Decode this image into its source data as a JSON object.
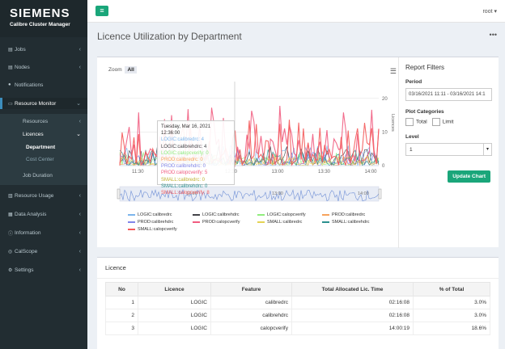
{
  "sidebar": {
    "brand": "SIEMENS",
    "product": "Calibre Cluster Manager",
    "items": [
      {
        "label": "Jobs",
        "icon": "server-icon"
      },
      {
        "label": "Nodes",
        "icon": "server-icon"
      },
      {
        "label": "Notifications",
        "icon": "bell-icon"
      },
      {
        "label": "Resource Monitor",
        "icon": "monitor-icon"
      },
      {
        "label": "Resource Usage",
        "icon": "bar-chart-icon"
      },
      {
        "label": "Data Analysis",
        "icon": "table-icon"
      },
      {
        "label": "Information",
        "icon": "info-icon"
      },
      {
        "label": "CalScope",
        "icon": "scope-icon"
      },
      {
        "label": "Settings",
        "icon": "gear-icon"
      }
    ],
    "resource_monitor_sub": {
      "resources": "Resources",
      "licences": "Licences",
      "department": "Department",
      "cost_center": "Cost Center",
      "job_duration": "Job Duration"
    }
  },
  "header": {
    "user": "root"
  },
  "page": {
    "title": "Licence Utilization by Department"
  },
  "chart_controls": {
    "zoom_label": "Zoom",
    "zoom_all": "All"
  },
  "filters": {
    "title": "Report Filters",
    "period_label": "Period",
    "period_value": "03/16/2021 11:11 - 03/16/2021 14:1",
    "plot_categories_label": "Plot Categories",
    "total_label": "Total",
    "limit_label": "Limit",
    "level_label": "Level",
    "level_value": "1",
    "update_button": "Update Chart"
  },
  "tooltip": {
    "time": "Tuesday, Mar 16, 2021 12:36:00",
    "lines": [
      "LOGIC:calibredrc: 4",
      "LOGIC:calibrehdrc: 4",
      "LOGIC:calopcverify: 0",
      "PROD:calibredrc: 0",
      "PROD:calibrehdrc: 0",
      "PROD:calopcverify: 5",
      "SMALL:calibredrc: 0",
      "SMALL:calibrehdrc: 0",
      "SMALL:calopcverify: 8"
    ]
  },
  "chart_data": {
    "type": "line",
    "x_ticks": [
      "11:30",
      "12:00",
      "12:30",
      "13:00",
      "13:30",
      "14:00"
    ],
    "y_ticks": [
      0,
      10,
      20
    ],
    "ylabel": "Licences",
    "navigator_ticks": [
      "12:00",
      "13:00",
      "14:00"
    ],
    "series": [
      {
        "name": "LOGIC:calibredrc",
        "color": "#7cb5ec"
      },
      {
        "name": "LOGIC:calibrehdrc",
        "color": "#434348"
      },
      {
        "name": "LOGIC:calopcverify",
        "color": "#90ed7d"
      },
      {
        "name": "PROD:calibredrc",
        "color": "#f7a35c"
      },
      {
        "name": "PROD:calibrehdrc",
        "color": "#8085e9"
      },
      {
        "name": "PROD:calopcverify",
        "color": "#f15c80"
      },
      {
        "name": "SMALL:calibredrc",
        "color": "#e4d354"
      },
      {
        "name": "SMALL:calibrehdrc",
        "color": "#2b908f"
      },
      {
        "name": "SMALL:calopcverify",
        "color": "#f45b5b"
      }
    ]
  },
  "licence_table": {
    "title": "Licence",
    "columns": [
      "No",
      "Licence",
      "Feature",
      "Total Allocated Lic. Time",
      "% of Total"
    ],
    "rows": [
      [
        "1",
        "LOGIC",
        "calibredrc",
        "02:16:08",
        "3.0%"
      ],
      [
        "2",
        "LOGIC",
        "calibrehdrc",
        "02:16:08",
        "3.0%"
      ],
      [
        "3",
        "LOGIC",
        "calopcverify",
        "14:00:19",
        "18.6%"
      ]
    ]
  }
}
